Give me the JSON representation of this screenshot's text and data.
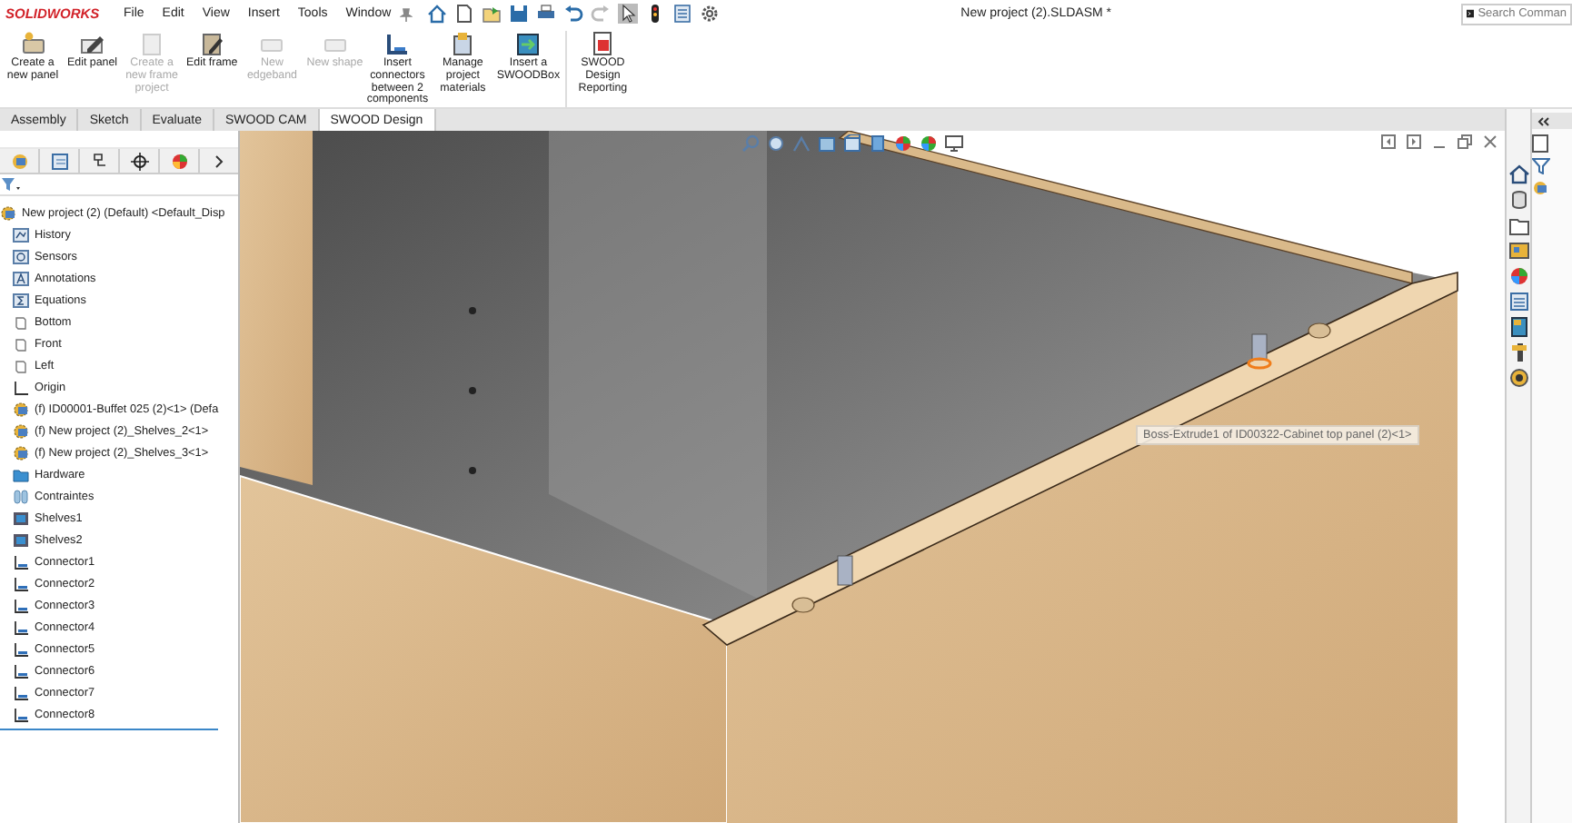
{
  "title_bar": {
    "logo": "SOLIDWORKS",
    "menu": [
      "File",
      "Edit",
      "View",
      "Insert",
      "Tools",
      "Window"
    ],
    "document_title": "New project (2).SLDASM *",
    "search": {
      "placeholder": "Search Comman"
    }
  },
  "ribbon": [
    {
      "label": "Create a new panel",
      "disabled": false
    },
    {
      "label": "Edit panel",
      "disabled": false
    },
    {
      "label": "Create a new frame project",
      "disabled": true
    },
    {
      "label": "Edit frame",
      "disabled": false
    },
    {
      "label": "New edgeband",
      "disabled": true
    },
    {
      "label": "New shape",
      "disabled": true
    },
    {
      "label": "Insert connectors between 2 components",
      "disabled": false
    },
    {
      "label": "Manage project materials",
      "disabled": false
    },
    {
      "label": "Insert a SWOODBox",
      "disabled": false
    },
    {
      "label": "SWOOD Design Reporting",
      "disabled": false
    }
  ],
  "tabs": [
    {
      "label": "Assembly",
      "selected": false
    },
    {
      "label": "Sketch",
      "selected": false
    },
    {
      "label": "Evaluate",
      "selected": false
    },
    {
      "label": "SWOOD CAM",
      "selected": false
    },
    {
      "label": "SWOOD Design",
      "selected": true
    }
  ],
  "feature_tree": {
    "root": "New project (2) (Default) <Default_Disp",
    "items": [
      {
        "kind": "history",
        "label": "History"
      },
      {
        "kind": "sensor",
        "label": "Sensors"
      },
      {
        "kind": "annotation",
        "label": "Annotations"
      },
      {
        "kind": "equation",
        "label": "Equations"
      },
      {
        "kind": "plane",
        "label": "Bottom"
      },
      {
        "kind": "plane",
        "label": "Front"
      },
      {
        "kind": "plane",
        "label": "Left"
      },
      {
        "kind": "origin",
        "label": "Origin"
      },
      {
        "kind": "component",
        "label": "(f) ID00001-Buffet 025 (2)<1> (Defa"
      },
      {
        "kind": "component",
        "label": "(f) New project (2)_Shelves_2<1>"
      },
      {
        "kind": "component",
        "label": "(f) New project (2)_Shelves_3<1>"
      },
      {
        "kind": "folder",
        "label": "Hardware"
      },
      {
        "kind": "mates",
        "label": "Contraintes"
      },
      {
        "kind": "part",
        "label": "Shelves1"
      },
      {
        "kind": "part",
        "label": "Shelves2"
      },
      {
        "kind": "connector",
        "label": "Connector1"
      },
      {
        "kind": "connector",
        "label": "Connector2"
      },
      {
        "kind": "connector",
        "label": "Connector3"
      },
      {
        "kind": "connector",
        "label": "Connector4"
      },
      {
        "kind": "connector",
        "label": "Connector5"
      },
      {
        "kind": "connector",
        "label": "Connector6"
      },
      {
        "kind": "connector",
        "label": "Connector7"
      },
      {
        "kind": "connector",
        "label": "Connector8"
      }
    ]
  },
  "viewport": {
    "tooltip": "Boss-Extrude1 of ID00322-Cabinet top panel (2)<1>"
  }
}
